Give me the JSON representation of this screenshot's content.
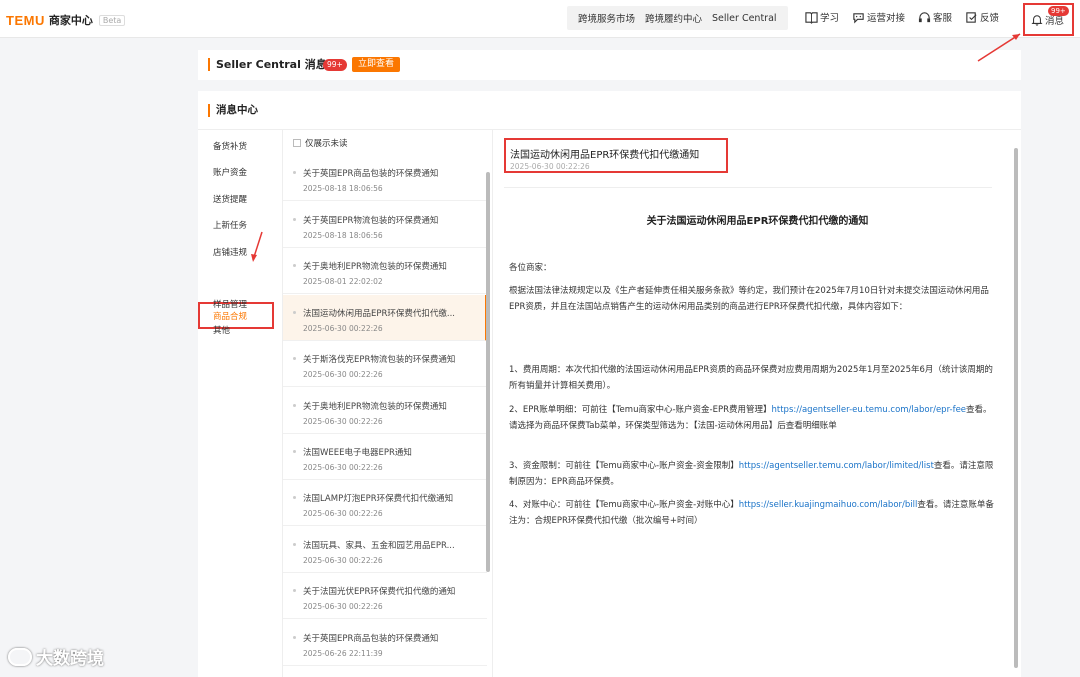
{
  "header": {
    "brand": "TEMU",
    "center": "商家中心",
    "beta": "Beta",
    "nav": [
      "跨境服务市场",
      "跨境履约中心",
      "Seller Central"
    ],
    "tools": [
      {
        "icon": "book-icon",
        "label": "学习"
      },
      {
        "icon": "chat-icon",
        "label": "运营对接"
      },
      {
        "icon": "headset-icon",
        "label": "客服"
      },
      {
        "icon": "feedback-icon",
        "label": "反馈"
      }
    ],
    "messages": {
      "icon": "bell-icon",
      "label": "消息",
      "badge": "99+"
    }
  },
  "seller_central": {
    "title": "Seller Central 消息",
    "count": "99+",
    "view_button": "立即查看"
  },
  "message_center": {
    "title": "消息中心",
    "categories": [
      "备货补货",
      "账户资金",
      "送货提醒",
      "上新任务",
      "店铺违规",
      "商品合规",
      "样品管理",
      "其他"
    ],
    "active_category": "商品合规",
    "filter_label": "仅展示未读",
    "messages": [
      {
        "title": "关于英国EPR商品包装的环保费通知",
        "date": "2025-08-18 18:06:56"
      },
      {
        "title": "关于英国EPR物流包装的环保费通知",
        "date": "2025-08-18 18:06:56"
      },
      {
        "title": "关于奥地利EPR物流包装的环保费通知",
        "date": "2025-08-01 22:02:02"
      },
      {
        "title": "法国运动休闲用品EPR环保费代扣代缴...",
        "date": "2025-06-30 00:22:26"
      },
      {
        "title": "关于斯洛伐克EPR物流包装的环保费通知",
        "date": "2025-06-30 00:22:26"
      },
      {
        "title": "关于奥地利EPR物流包装的环保费通知",
        "date": "2025-06-30 00:22:26"
      },
      {
        "title": "法国WEEE电子电器EPR通知",
        "date": "2025-06-30 00:22:26"
      },
      {
        "title": "法国LAMP灯泡EPR环保费代扣代缴通知",
        "date": "2025-06-30 00:22:26"
      },
      {
        "title": "法国玩具、家具、五金和园艺用品EPR...",
        "date": "2025-06-30 00:22:26"
      },
      {
        "title": "关于法国光伏EPR环保费代扣代缴的通知",
        "date": "2025-06-30 00:22:26"
      },
      {
        "title": "关于英国EPR商品包装的环保费通知",
        "date": "2025-06-26 22:11:39"
      }
    ]
  },
  "detail": {
    "title": "法国运动休闲用品EPR环保费代扣代缴通知",
    "date": "2025-06-30 00:22:26",
    "heading": "关于法国运动休闲用品EPR环保费代扣代缴的通知",
    "greeting": "各位商家：",
    "intro": "根据法国法律法规规定以及《生产者延伸责任相关服务条款》等约定，我们预计在2025年7月10日针对未提交法国运动休闲用品EPR资质，并且在法国站点销售产生的运动休闲用品类别的商品进行EPR环保费代扣代缴，具体内容如下：",
    "item1": "1、费用周期：本次代扣代缴的法国运动休闲用品EPR资质的商品环保费对应费用周期为2025年1月至2025年6月（统计该周期的所有销量并计算相关费用）。",
    "item2_pre": "2、EPR账单明细：可前往【Temu商家中心-账户资金-EPR费用管理】",
    "item2_link": "https://agentseller-eu.temu.com/labor/epr-fee",
    "item2_post": "查看。请选择为商品环保费Tab菜单，环保类型筛选为：【法国-运动休闲用品】后查看明细账单",
    "item3_pre": "3、资金限制：可前往【Temu商家中心-账户资金-资金限制】",
    "item3_link": "https://agentseller.temu.com/labor/limited/list",
    "item3_post": "查看。请注意限制原因为：EPR商品环保费。",
    "item4_pre": "4、对账中心：可前往【Temu商家中心-账户资金-对账中心】",
    "item4_link": "https://seller.kuajingmaihuo.com/labor/bill",
    "item4_post": "查看。请注意账单备注为：合规EPR环保费代扣代缴（批次编号+时间）"
  },
  "watermark": "大数跨境"
}
